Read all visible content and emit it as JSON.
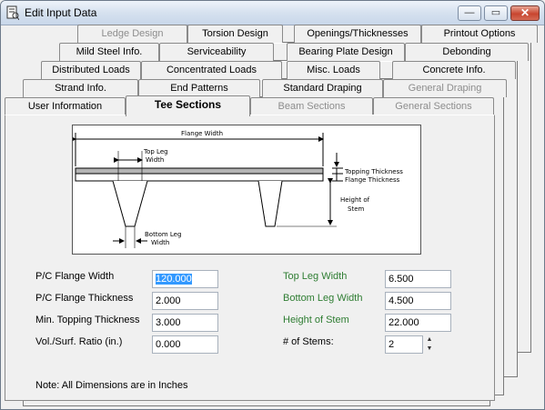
{
  "window": {
    "title": "Edit Input Data",
    "buttons": {
      "minimize": "—",
      "maximize": "▭",
      "close": "✕"
    }
  },
  "tabs": {
    "row1": [
      "Ledge Design",
      "Torsion Design",
      "Openings/Thicknesses",
      "Printout Options"
    ],
    "row2": [
      "Mild Steel Info.",
      "Serviceability",
      "Bearing Plate Design",
      "Debonding"
    ],
    "row3": [
      "Distributed Loads",
      "Concentrated Loads",
      "Misc. Loads",
      "Concrete Info."
    ],
    "row4": [
      "Strand Info.",
      "End Patterns",
      "Standard Draping",
      "General Draping"
    ],
    "row5": [
      "User Information",
      "Tee Sections",
      "Beam Sections",
      "General Sections"
    ]
  },
  "diagram": {
    "flange_width": "Flange Width",
    "top_leg_1": "Top Leg",
    "top_leg_2": "Width",
    "topping_thickness": "Topping Thickness",
    "flange_thickness": "Flange Thickness",
    "height_1": "Height of",
    "height_2": "Stem",
    "bottom_leg_1": "Bottom Leg",
    "bottom_leg_2": "Width"
  },
  "form": {
    "left": [
      {
        "label": "P/C Flange Width",
        "value": "120.000"
      },
      {
        "label": "P/C Flange Thickness",
        "value": "2.000"
      },
      {
        "label": "Min. Topping Thickness",
        "value": "3.000"
      },
      {
        "label": "Vol./Surf. Ratio (in.)",
        "value": "0.000"
      }
    ],
    "right": [
      {
        "label": "Top Leg Width",
        "value": "6.500"
      },
      {
        "label": "Bottom Leg Width",
        "value": "4.500"
      },
      {
        "label": "Height of Stem",
        "value": "22.000"
      },
      {
        "label": "# of Stems:",
        "value": "2"
      }
    ]
  },
  "note": "Note: All Dimensions are in Inches",
  "colors": {
    "green_label": "#2e7d32",
    "selection": "#3399ff"
  }
}
